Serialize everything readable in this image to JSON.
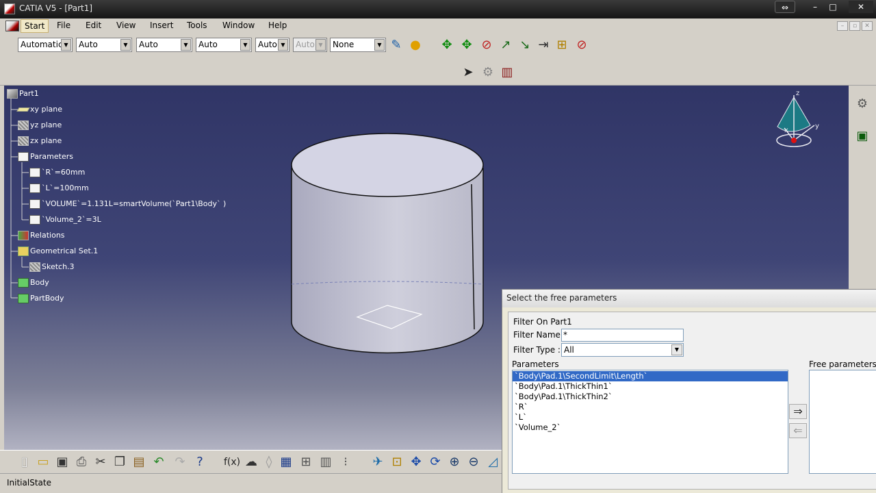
{
  "window": {
    "title": "CATIA V5 - [Part1]",
    "controls": [
      "⇔",
      "–",
      "□",
      "✕"
    ]
  },
  "menu": {
    "items": [
      "Start",
      "File",
      "Edit",
      "View",
      "Insert",
      "Tools",
      "Window",
      "Help"
    ]
  },
  "graphic_properties": {
    "combos": [
      {
        "value": "Automatic",
        "disabled": false
      },
      {
        "value": "Auto",
        "disabled": false
      },
      {
        "value": "Auto",
        "disabled": false
      },
      {
        "value": "Auto",
        "disabled": false
      },
      {
        "value": "Auto",
        "disabled": false
      },
      {
        "value": "Auto",
        "disabled": true
      },
      {
        "value": "None",
        "disabled": false
      }
    ],
    "icons": [
      "painter-icon",
      "material-sphere-icon",
      "move-icon",
      "snap-icon",
      "remove-icon",
      "sweep-icon",
      "line-icon",
      "distance-icon",
      "measure-icon",
      "hide-icon",
      "select-arrow-icon",
      "gear-wheel-icon",
      "catalog-icon"
    ]
  },
  "spec_tree": {
    "items": [
      {
        "label": "Part1",
        "icon": "part-icon"
      },
      {
        "label": "xy plane",
        "icon": "plane-icon"
      },
      {
        "label": "yz plane",
        "icon": "plane-icon"
      },
      {
        "label": "zx plane",
        "icon": "plane-icon"
      },
      {
        "label": "Parameters",
        "icon": "parameters-icon"
      },
      {
        "label": "`R`=60mm",
        "icon": "parameter-icon"
      },
      {
        "label": "`L`=100mm",
        "icon": "parameter-icon"
      },
      {
        "label": "`VOLUME`=1.131L=smartVolume(`Part1\\Body` )",
        "icon": "parameter-formula-icon"
      },
      {
        "label": "`Volume_2`=3L",
        "icon": "parameter-icon"
      },
      {
        "label": "Relations",
        "icon": "relations-icon"
      },
      {
        "label": "Geometrical Set.1",
        "icon": "geometrical-set-icon"
      },
      {
        "label": "Sketch.3",
        "icon": "sketch-icon"
      },
      {
        "label": "Body",
        "icon": "body-icon"
      },
      {
        "label": "PartBody",
        "icon": "partbody-icon"
      }
    ]
  },
  "compass": {
    "x_label": "x",
    "y_label": "y",
    "z_label": "z"
  },
  "bottom_toolbar": {
    "icons": [
      "new-icon",
      "open-icon",
      "save-icon",
      "print-icon",
      "cut-icon",
      "copy-icon",
      "paste-icon",
      "undo-icon",
      "redo-icon",
      "whats-this-icon",
      "formula-icon",
      "comment-icon",
      "knowledge-icon",
      "table-icon",
      "design-table-icon",
      "catalog-icon",
      "rule-icon",
      "fly-mode-icon",
      "fit-all-icon",
      "pan-icon",
      "rotate-icon",
      "zoom-in-icon",
      "zoom-out-icon",
      "normal-view-icon"
    ]
  },
  "status": {
    "text": "InitialState"
  },
  "dialog": {
    "title": "Select the free parameters",
    "filter_on": "Filter On Part1",
    "filter_name_label": "Filter Name :",
    "filter_name_value": "*",
    "filter_type_label": "Filter Type :",
    "filter_type_value": "All",
    "parameters_label": "Parameters",
    "free_params_label": "Free parameters fo",
    "parameters": [
      "`Body\\Pad.1\\SecondLimit\\Length`",
      "`Body\\Pad.1\\ThickThin1`",
      "`Body\\Pad.1\\ThickThin2`",
      "`R`",
      "`L`",
      "`Volume_2`"
    ],
    "selected_index": 0
  }
}
